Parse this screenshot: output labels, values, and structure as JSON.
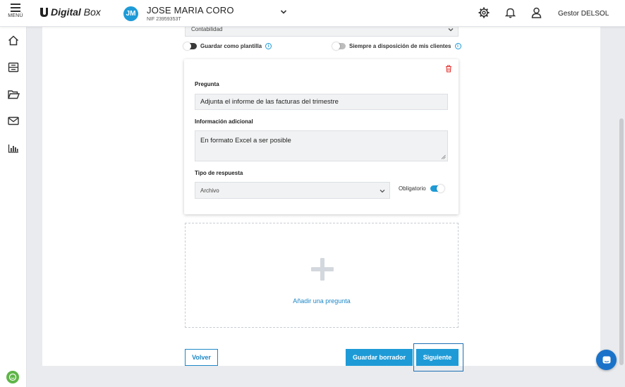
{
  "header": {
    "menu_label": "MENÚ",
    "logo_text_bold": "Digital",
    "logo_text": " Box",
    "avatar_initials": "JM",
    "client_name": "JOSE MARIA CORO",
    "client_nif": "NIF 23959353T",
    "user_name": "Gestor DELSOL"
  },
  "form": {
    "category_value": "Contabilidad",
    "save_template_label": "Guardar como plantilla",
    "client_available_label": "Siempre a disposición de mis clientes",
    "question": {
      "question_label": "Pregunta",
      "question_value": "Adjunta el informe de las facturas del trimestre",
      "extra_info_label": "Información adicional",
      "extra_info_value": "En formato Excel a ser posible",
      "response_type_label": "Tipo de respuesta",
      "response_type_value": "Archivo",
      "required_label": "Obligatorio"
    },
    "add_question_label": "Añadir una pregunta"
  },
  "actions": {
    "back_label": "Volver",
    "save_draft_label": "Guardar borrador",
    "next_label": "Siguiente"
  },
  "colors": {
    "accent": "#1e9bd7",
    "link": "#1e88c7",
    "danger": "#e53935",
    "toggle_off": "#3a3a3a",
    "support_green": "#5fb548",
    "chat_blue": "#1a73c9"
  }
}
